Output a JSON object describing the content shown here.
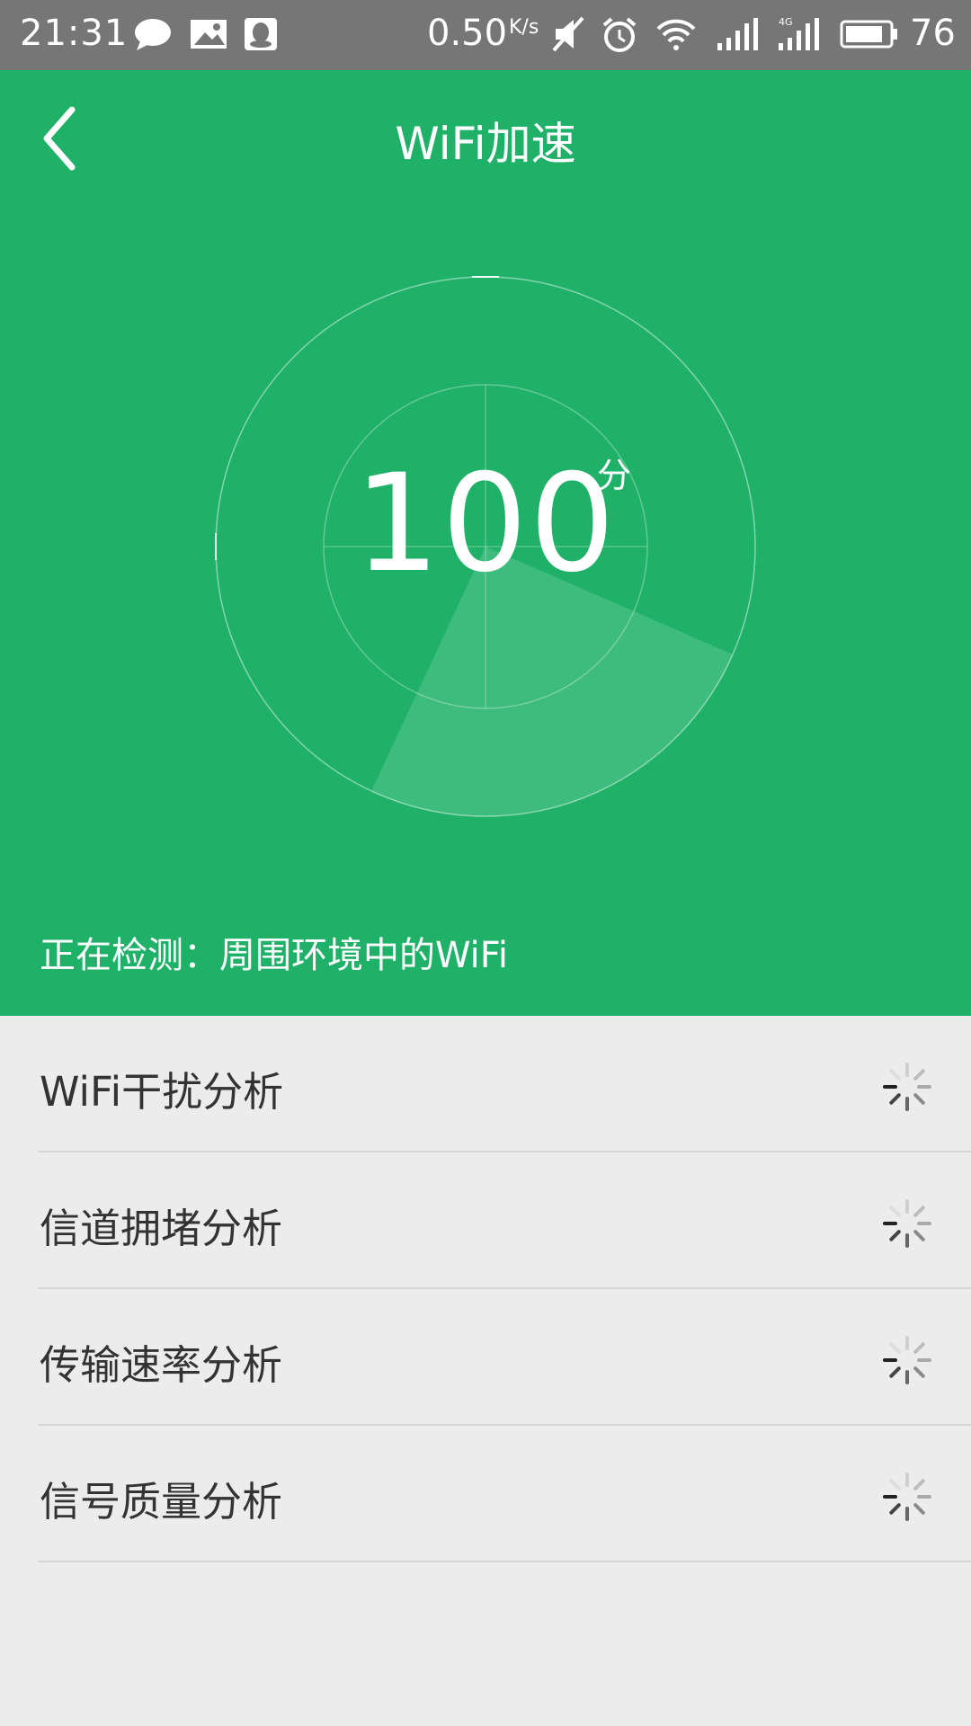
{
  "status_bar": {
    "time": "21:31",
    "net_speed": "0.50",
    "net_speed_unit": "K/s",
    "battery_level": "76",
    "icons": [
      "message-icon",
      "image-icon",
      "qq-icon",
      "mute-icon",
      "alarm-icon",
      "wifi-icon",
      "signal-icon",
      "signal-4g-icon",
      "battery-icon"
    ]
  },
  "header": {
    "title": "WiFi加速",
    "score": "100",
    "score_unit": "分",
    "status_text": "正在检测：周围环境中的WiFi"
  },
  "checks": [
    {
      "label": "WiFi干扰分析",
      "icon": "loading-spinner-icon"
    },
    {
      "label": "信道拥堵分析",
      "icon": "loading-spinner-icon"
    },
    {
      "label": "传输速率分析",
      "icon": "loading-spinner-icon"
    },
    {
      "label": "信号质量分析",
      "icon": "loading-spinner-icon"
    }
  ],
  "colors": {
    "accent": "#1fb168",
    "status_bar": "#767676",
    "background": "#ececec"
  }
}
